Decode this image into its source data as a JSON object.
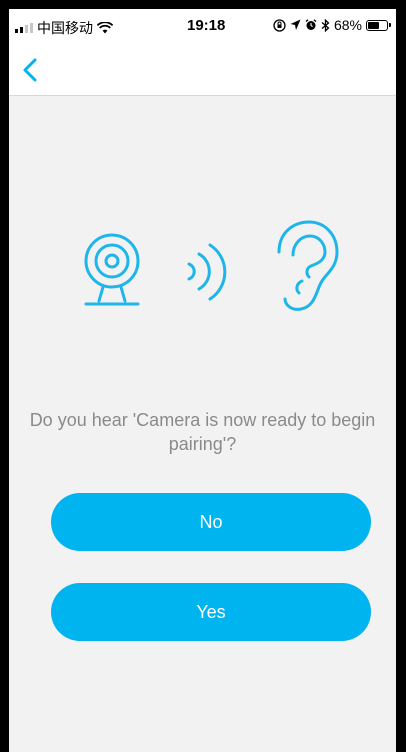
{
  "status_bar": {
    "carrier": "中国移动",
    "time": "19:18",
    "battery_percent": "68%",
    "battery_level": 0.68,
    "icons": [
      "signal-icon",
      "wifi-icon",
      "orientation-lock-icon",
      "location-icon",
      "alarm-icon",
      "bluetooth-icon",
      "battery-icon"
    ]
  },
  "nav": {
    "back_icon": "chevron-left-icon"
  },
  "illustration": {
    "icons": [
      "webcam-icon",
      "sound-waves-icon",
      "ear-icon"
    ]
  },
  "prompt": {
    "question": "Do you hear 'Camera  is now ready to begin pairing'?"
  },
  "actions": {
    "no_label": "No",
    "yes_label": "Yes"
  },
  "colors": {
    "accent": "#00b5ef",
    "icon_accent": "#1eb6ea",
    "background": "#f2f2f2",
    "text_muted": "#8a8a8a"
  }
}
